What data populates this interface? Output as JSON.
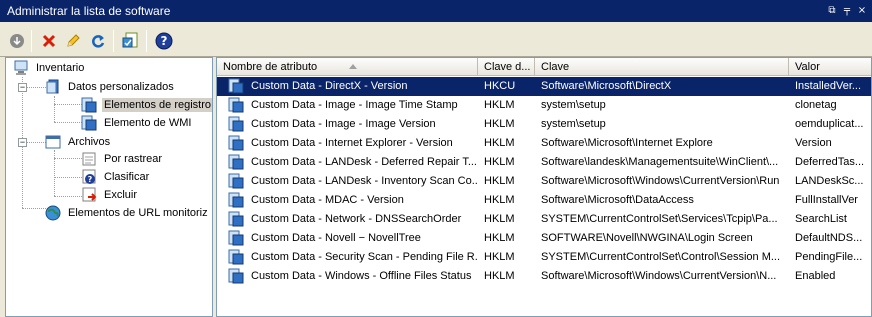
{
  "window": {
    "title": "Administrar la lista de software",
    "buttons": [
      "⧉",
      "╤",
      "×"
    ]
  },
  "toolbar": {
    "icons": [
      "import-icon",
      "delete-icon",
      "edit-icon",
      "refresh-icon",
      "software-list-icon",
      "help-icon"
    ]
  },
  "tree": {
    "items": [
      {
        "label": "Inventario",
        "icon": "computer-icon"
      },
      {
        "label": "Datos personalizados",
        "icon": "data-icon"
      },
      {
        "label": "Elementos de registro",
        "icon": "registry-icon"
      },
      {
        "label": "Elemento de WMI",
        "icon": "wmi-icon"
      },
      {
        "label": "Archivos",
        "icon": "files-icon"
      },
      {
        "label": "Por rastrear",
        "icon": "track-icon"
      },
      {
        "label": "Clasificar",
        "icon": "classify-icon"
      },
      {
        "label": "Excluir",
        "icon": "exclude-icon"
      },
      {
        "label": "Elementos de URL monitoriz",
        "icon": "globe-icon"
      }
    ]
  },
  "grid": {
    "columns": [
      "Nombre de atributo",
      "Clave d...",
      "Clave",
      "Valor"
    ],
    "rows": [
      [
        "Custom Data - DirectX - Version",
        "HKCU",
        "Software\\Microsoft\\DirectX",
        "InstalledVer..."
      ],
      [
        "Custom Data - Image - Image Time Stamp",
        "HKLM",
        "system\\setup",
        "clonetag"
      ],
      [
        "Custom Data - Image - Image Version",
        "HKLM",
        "system\\setup",
        "oemduplicat..."
      ],
      [
        "Custom Data - Internet Explorer - Version",
        "HKLM",
        "Software\\Microsoft\\Internet Explore",
        "Version"
      ],
      [
        "Custom Data - LANDesk - Deferred Repair T...",
        "HKLM",
        "Software\\landesk\\Managementsuite\\WinClient\\...",
        "DeferredTas..."
      ],
      [
        "Custom Data - LANDesk - Inventory Scan Co...",
        "HKLM",
        "Software\\Microsoft\\Windows\\CurrentVersion\\Run",
        "LANDeskSc..."
      ],
      [
        "Custom Data - MDAC - Version",
        "HKLM",
        "Software\\Microsoft\\DataAccess",
        "FullInstallVer"
      ],
      [
        "Custom Data - Network - DNSSearchOrder",
        "HKLM",
        "SYSTEM\\CurrentControlSet\\Services\\Tcpip\\Pa...",
        "SearchList"
      ],
      [
        "Custom Data - Novell − NovellTree",
        "HKLM",
        "SOFTWARE\\Novell\\NWGINA\\Login Screen",
        "DefaultNDS..."
      ],
      [
        "Custom Data - Security Scan - Pending File R...",
        "HKLM",
        "SYSTEM\\CurrentControlSet\\Control\\Session M...",
        "PendingFile..."
      ],
      [
        "Custom Data - Windows - Offline Files Status",
        "HKLM",
        "Software\\Microsoft\\Windows\\CurrentVersion\\N...",
        "Enabled"
      ]
    ]
  },
  "colors": {
    "titlebar": "#0a246a",
    "selection": "#0a246a",
    "window_bg": "#ece9d8"
  }
}
